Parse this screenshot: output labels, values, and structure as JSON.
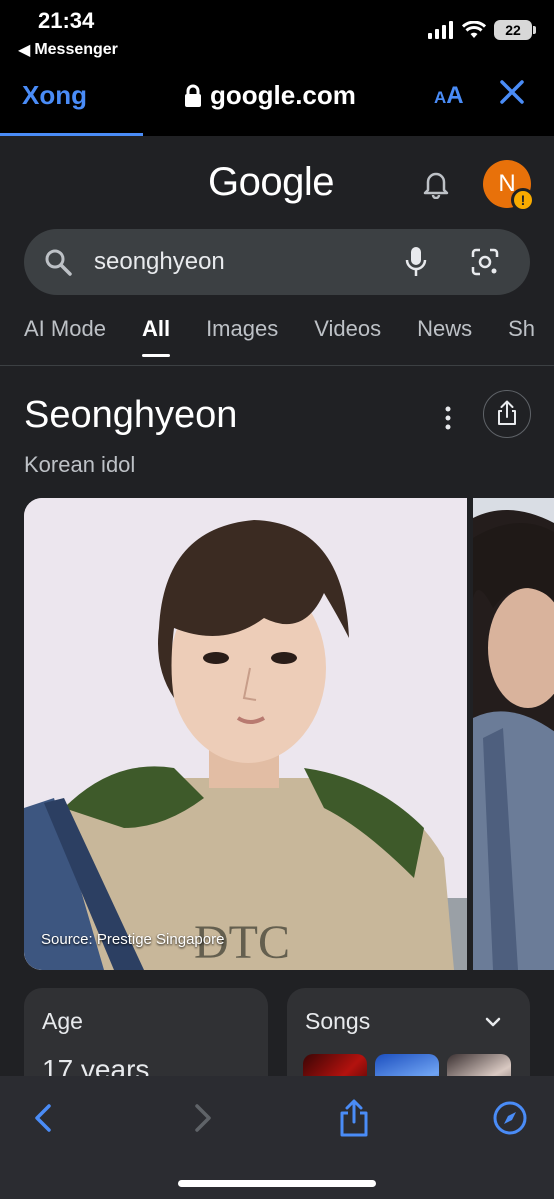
{
  "status_bar": {
    "time": "21:34",
    "back_app": "Messenger",
    "battery": "22",
    "icons": [
      "signal-icon",
      "wifi-icon",
      "battery-icon"
    ]
  },
  "browser": {
    "done_label": "Xong",
    "domain": "google.com",
    "text_size_label": "AA",
    "accent_color": "#4a8cf7"
  },
  "google": {
    "logo": "Google",
    "avatar_letter": "N",
    "avatar_badge": "!",
    "search_query": "seonghyeon",
    "tabs": [
      {
        "label": "AI Mode",
        "active": false
      },
      {
        "label": "All",
        "active": true
      },
      {
        "label": "Images",
        "active": false
      },
      {
        "label": "Videos",
        "active": false
      },
      {
        "label": "News",
        "active": false
      },
      {
        "label": "Sh",
        "active": false
      }
    ]
  },
  "knowledge_panel": {
    "title": "Seonghyeon",
    "subtitle": "Korean idol",
    "image_source": "Source: Prestige Singapore",
    "cards": {
      "age": {
        "title": "Age",
        "value": "17 years"
      },
      "songs": {
        "title": "Songs"
      }
    }
  },
  "toolbar": {
    "icons": [
      "back-icon",
      "forward-icon",
      "share-icon",
      "compass-icon"
    ]
  }
}
